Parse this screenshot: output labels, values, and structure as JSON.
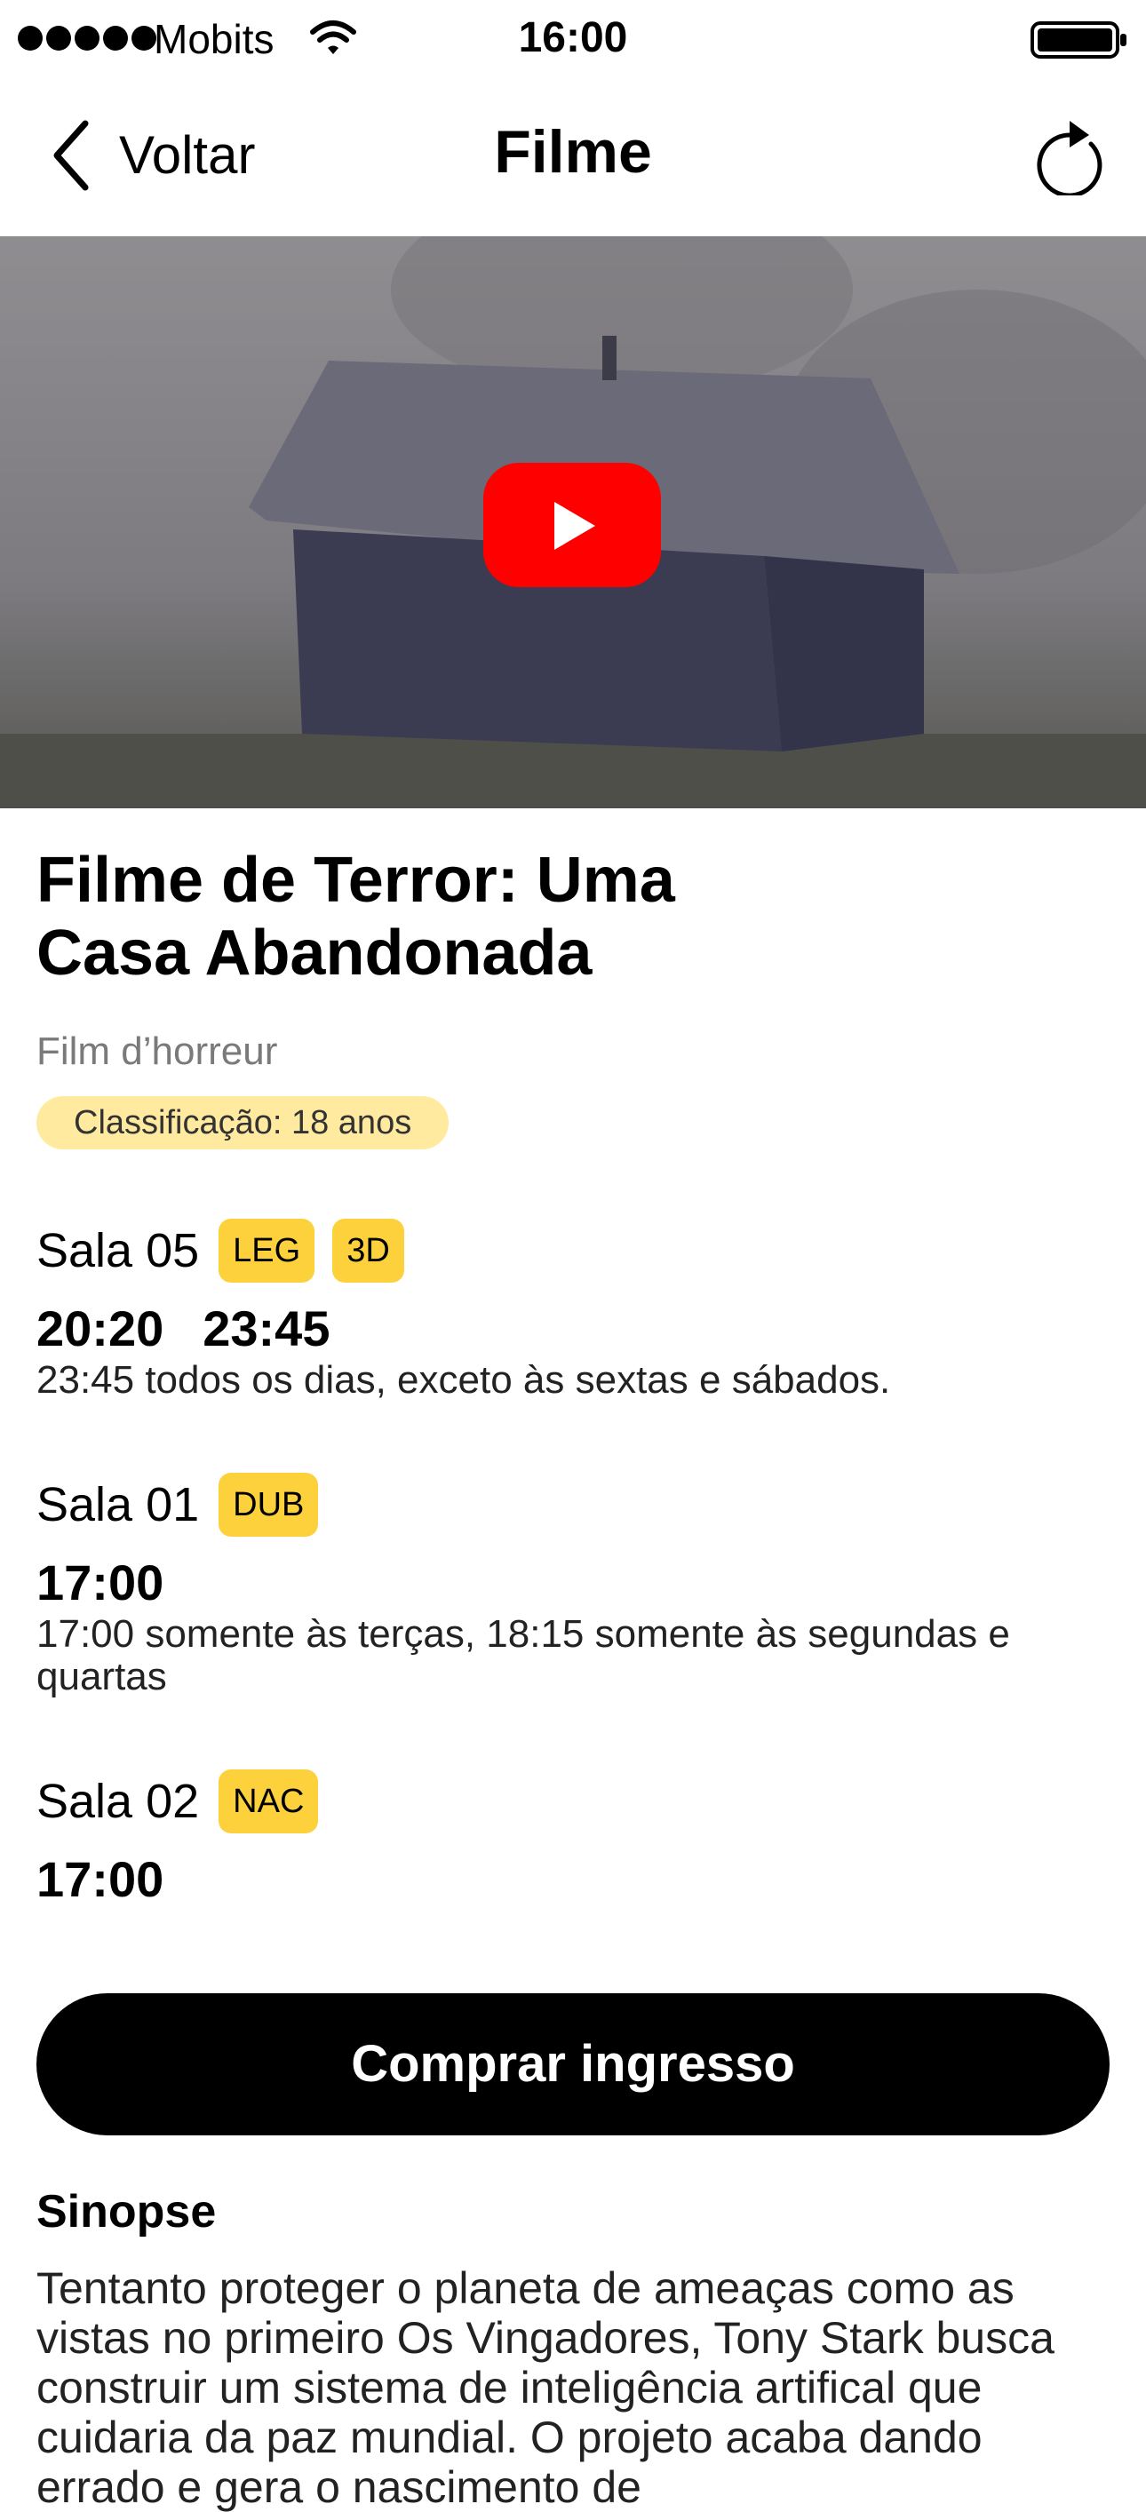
{
  "status_bar": {
    "carrier": "Mobits",
    "time": "16:00"
  },
  "nav": {
    "back_label": "Voltar",
    "title": "Filme"
  },
  "movie": {
    "title": "Filme de Terror: Uma Casa Abandonada",
    "original_title": "Film d’horreur",
    "rating": "Classificação: 18 anos"
  },
  "sessions": [
    {
      "room": "Sala 05",
      "badges": [
        "LEG",
        "3D"
      ],
      "times": [
        "20:20",
        "23:45"
      ],
      "note": "23:45 todos os dias, exceto às  sextas e sábados."
    },
    {
      "room": "Sala 01",
      "badges": [
        "DUB"
      ],
      "times": [
        "17:00"
      ],
      "note": "17:00 somente às terças, 18:15 somente às segundas e quartas"
    },
    {
      "room": "Sala 02",
      "badges": [
        "NAC"
      ],
      "times": [
        "17:00"
      ],
      "note": ""
    }
  ],
  "buy_button_label": "Comprar ingresso",
  "synopsis": {
    "title": "Sinopse",
    "text": "Tentanto proteger o   planeta de ameaças como as vistas no primeiro Os Vingadores, Tony Stark busca construir um sistema de inteligência artifical que cuidaria da paz mundial. O projeto acaba dando errado e gera o nascimento de"
  },
  "colors": {
    "badge_yellow": "#fdd13c",
    "rating_yellow": "#ffeaa0",
    "youtube_red": "#ff0000"
  }
}
